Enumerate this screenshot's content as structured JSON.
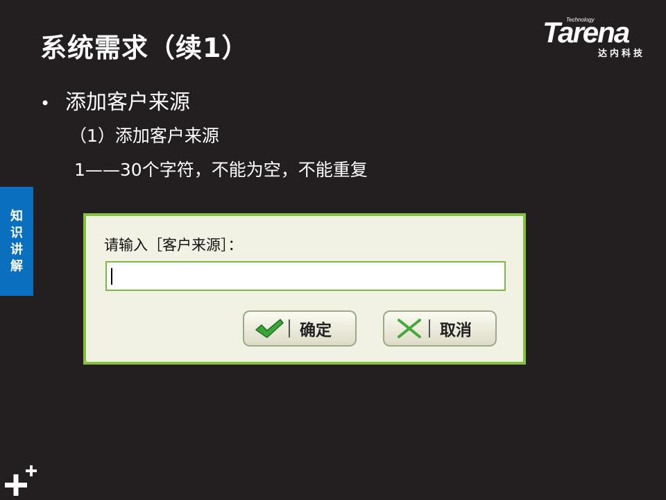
{
  "slide": {
    "title": "系统需求（续1）",
    "bullet": "添加客户来源",
    "subheading": "（1）添加客户来源",
    "constraint": "1——30个字符，不能为空，不能重复"
  },
  "logo": {
    "tag": "Technology",
    "brand": "Tarena",
    "subtitle": "达内科技"
  },
  "side_tab": {
    "label": "知识讲解",
    "color": "#0b6fc0"
  },
  "dialog": {
    "prompt": "请输入［客户来源］：",
    "input_value": "",
    "ok_button": "确定",
    "cancel_button": "取消",
    "border_color": "#86c13d",
    "ok_icon": "check-icon",
    "cancel_icon": "x-icon"
  }
}
